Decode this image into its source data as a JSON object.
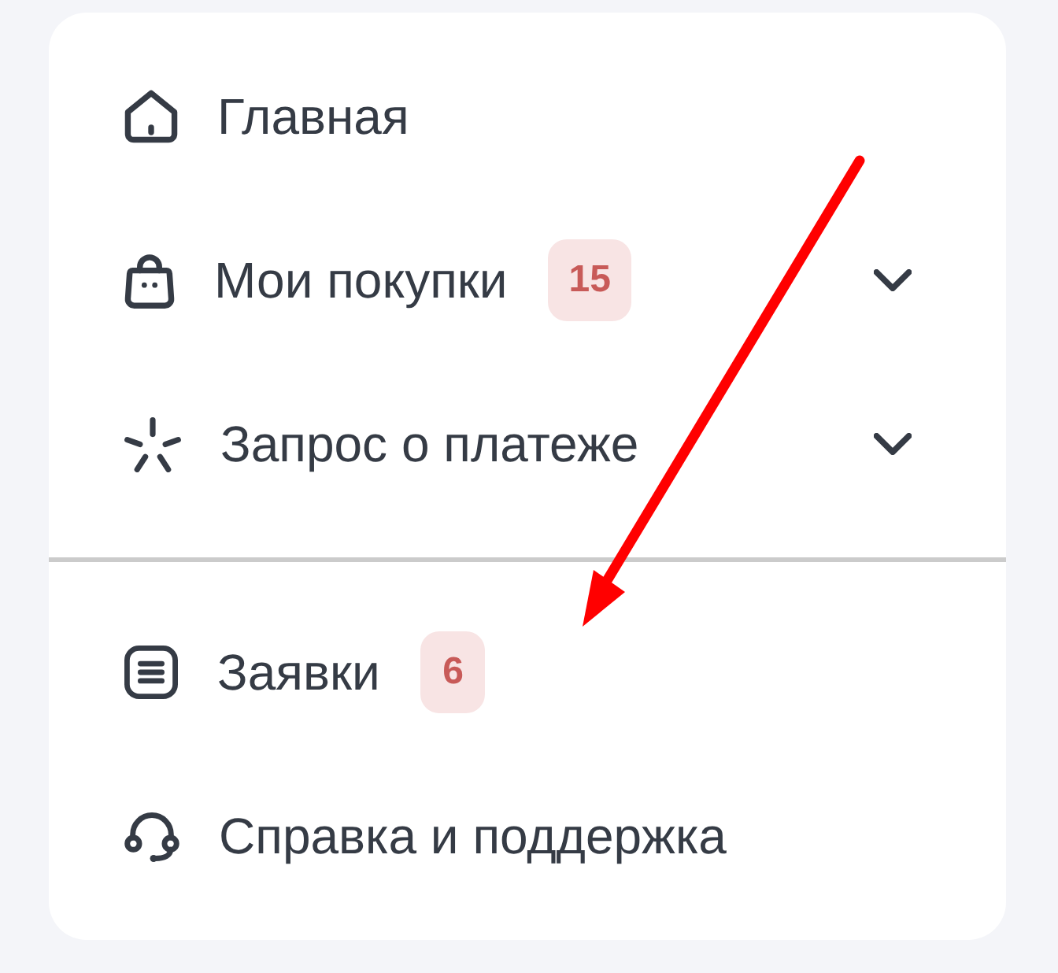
{
  "menu": {
    "sections": [
      {
        "items": [
          {
            "label": "Главная"
          },
          {
            "label": "Мои покупки",
            "badge": "15",
            "expanded": false
          },
          {
            "label": "Запрос о платеже",
            "expanded": false
          }
        ]
      },
      {
        "items": [
          {
            "label": "Заявки",
            "badge": "6"
          },
          {
            "label": "Справка и поддержка"
          }
        ]
      }
    ]
  }
}
